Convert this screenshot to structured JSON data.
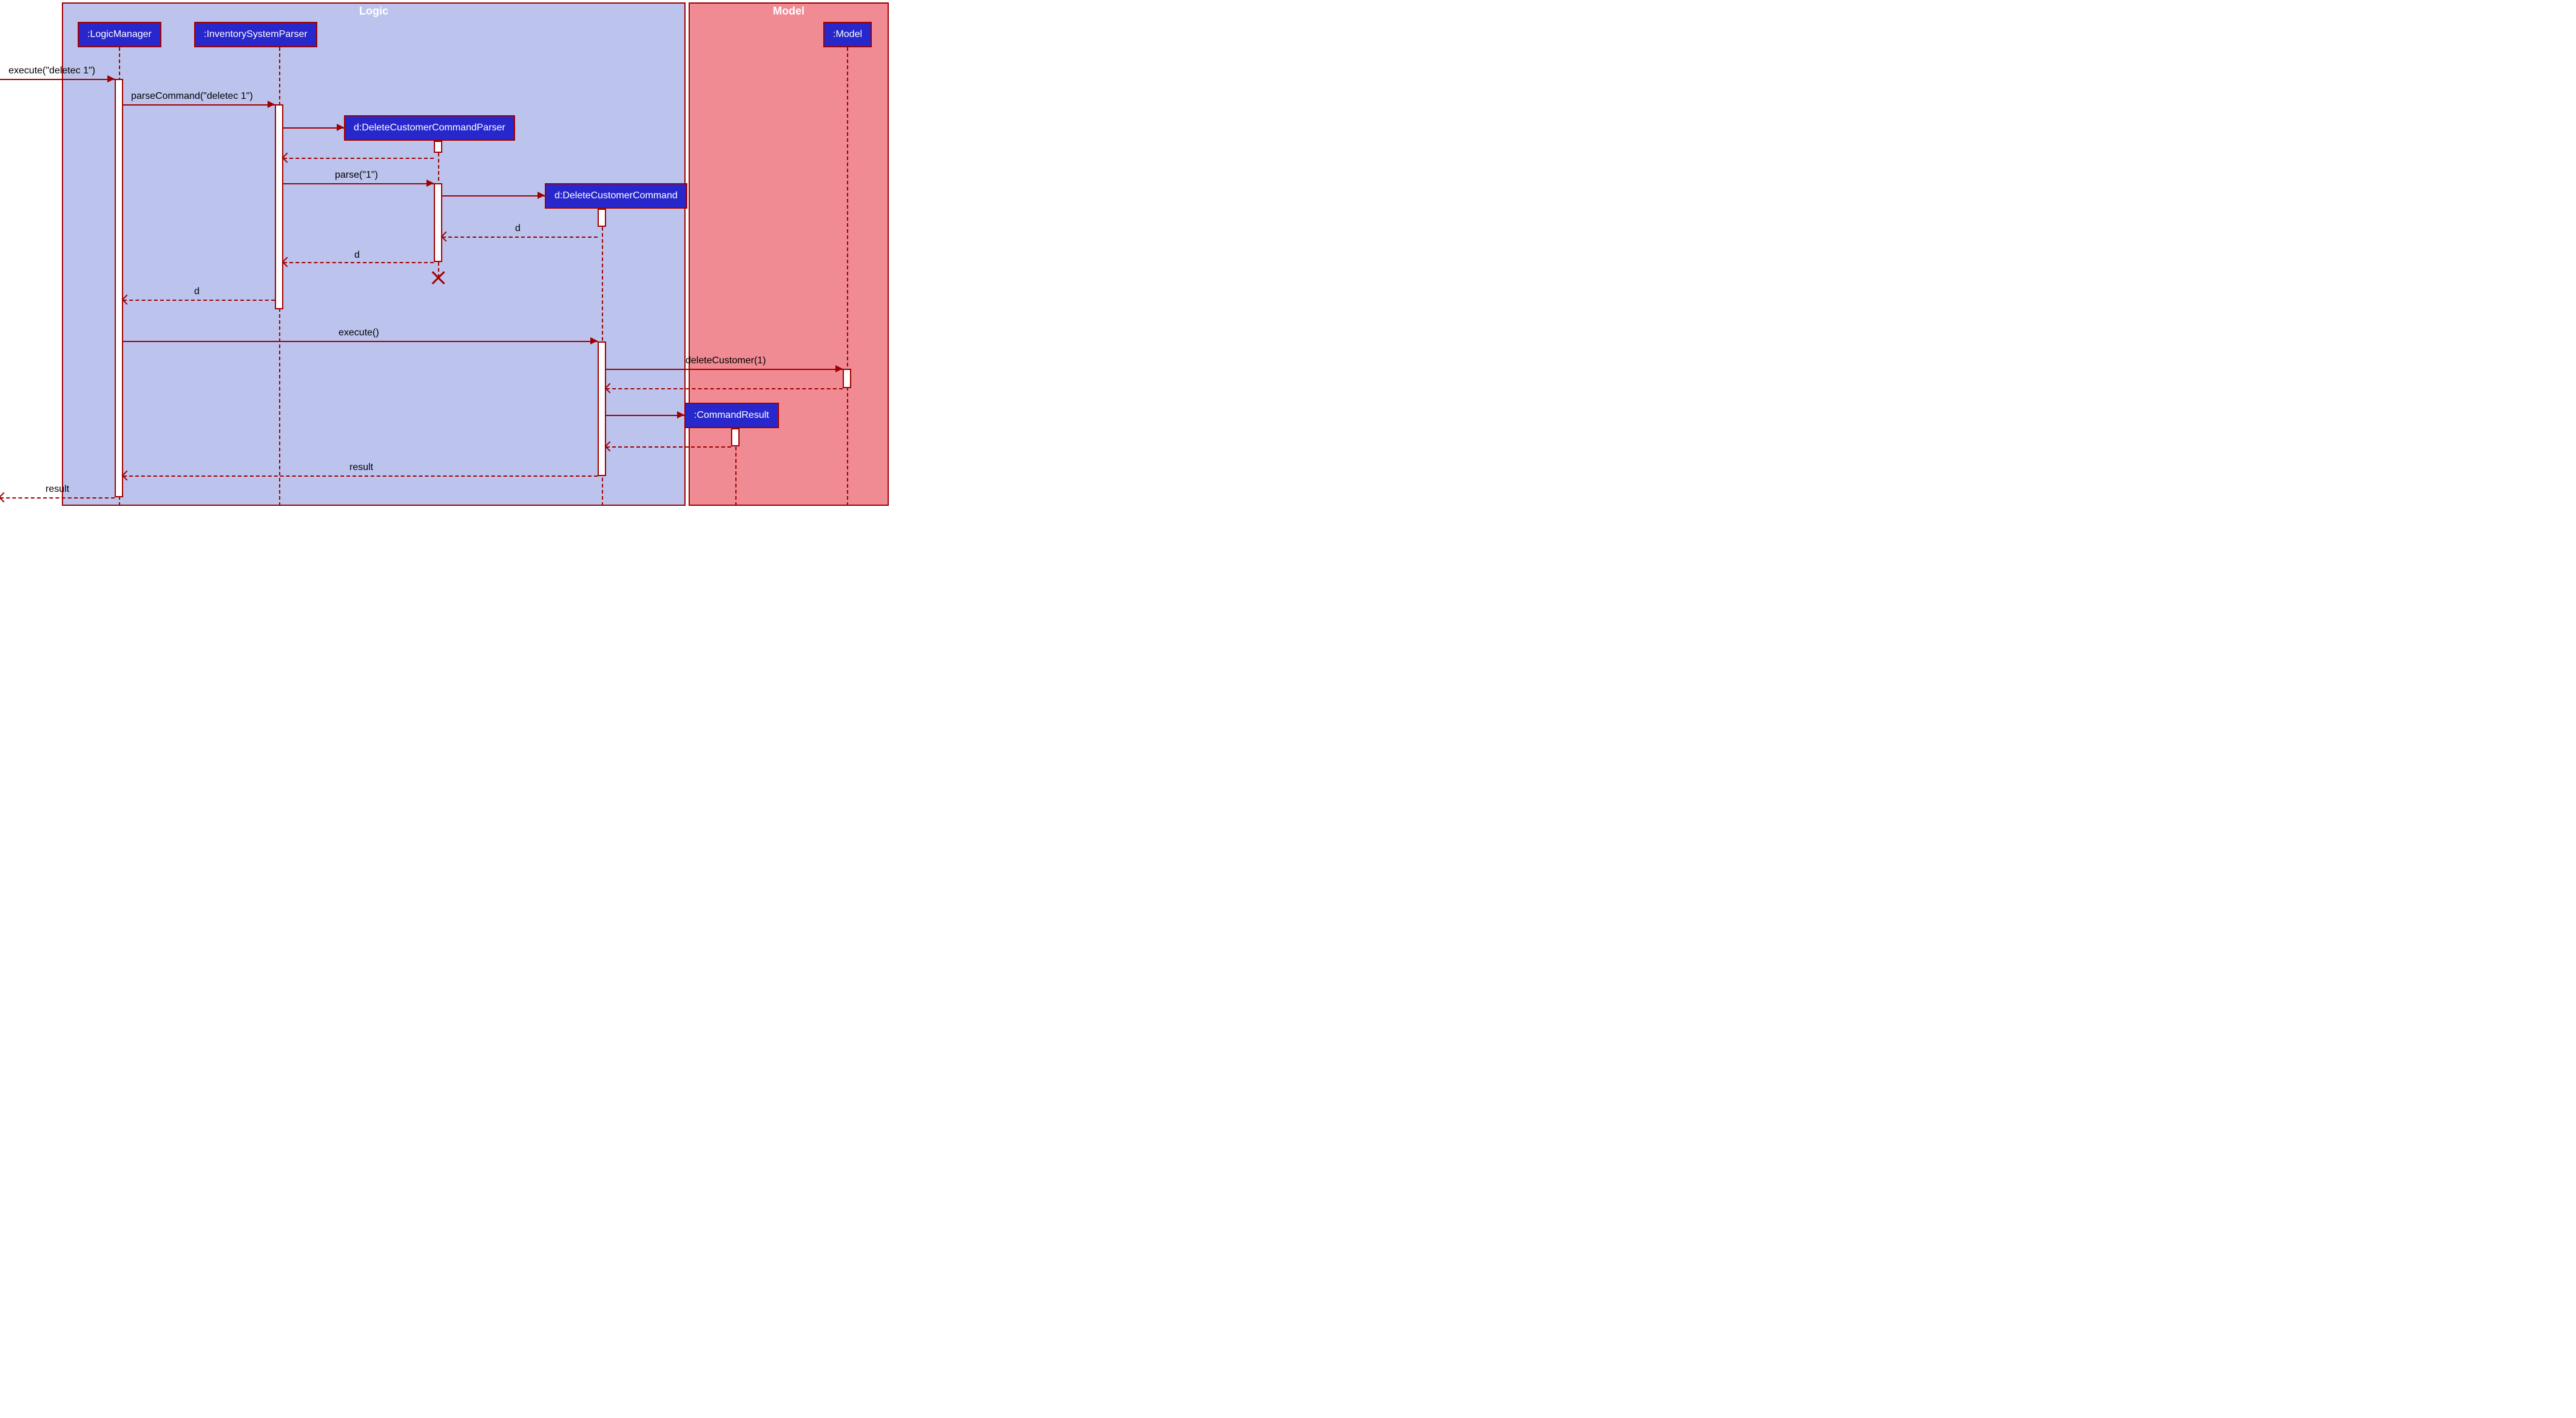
{
  "frames": {
    "logic": "Logic",
    "model": "Model"
  },
  "participants": {
    "logicManager": ":LogicManager",
    "inventoryParser": ":InventorySystemParser",
    "deleteParser": "d:DeleteCustomerCommandParser",
    "deleteCommand": "d:DeleteCustomerCommand",
    "commandResult": ":CommandResult",
    "model": ":Model"
  },
  "messages": {
    "m1": "execute(\"deletec 1\")",
    "m2": "parseCommand(\"deletec 1\")",
    "m3": "parse(\"1\")",
    "m4": "d",
    "m5": "d",
    "m6": "d",
    "m7": "execute()",
    "m8": "deleteCustomer(1)",
    "m9": "result",
    "m10": "result"
  },
  "chart_data": {
    "type": "sequence",
    "frames": [
      {
        "name": "Logic",
        "contains": [
          ":LogicManager",
          ":InventorySystemParser",
          "d:DeleteCustomerCommandParser",
          "d:DeleteCustomerCommand",
          ":CommandResult"
        ]
      },
      {
        "name": "Model",
        "contains": [
          ":Model"
        ]
      }
    ],
    "participants": [
      ":LogicManager",
      ":InventorySystemParser",
      "d:DeleteCustomerCommandParser",
      "d:DeleteCustomerCommand",
      ":Model",
      ":CommandResult"
    ],
    "messages": [
      {
        "from": "external",
        "to": ":LogicManager",
        "label": "execute(\"deletec 1\")",
        "type": "sync"
      },
      {
        "from": ":LogicManager",
        "to": ":InventorySystemParser",
        "label": "parseCommand(\"deletec 1\")",
        "type": "sync"
      },
      {
        "from": ":InventorySystemParser",
        "to": "d:DeleteCustomerCommandParser",
        "label": "",
        "type": "create"
      },
      {
        "from": "d:DeleteCustomerCommandParser",
        "to": ":InventorySystemParser",
        "label": "",
        "type": "return"
      },
      {
        "from": ":InventorySystemParser",
        "to": "d:DeleteCustomerCommandParser",
        "label": "parse(\"1\")",
        "type": "sync"
      },
      {
        "from": "d:DeleteCustomerCommandParser",
        "to": "d:DeleteCustomerCommand",
        "label": "",
        "type": "create"
      },
      {
        "from": "d:DeleteCustomerCommand",
        "to": "d:DeleteCustomerCommandParser",
        "label": "d",
        "type": "return"
      },
      {
        "from": "d:DeleteCustomerCommandParser",
        "to": ":InventorySystemParser",
        "label": "d",
        "type": "return"
      },
      {
        "from": "d:DeleteCustomerCommandParser",
        "to": "destroy",
        "label": "",
        "type": "destroy"
      },
      {
        "from": ":InventorySystemParser",
        "to": ":LogicManager",
        "label": "d",
        "type": "return"
      },
      {
        "from": ":LogicManager",
        "to": "d:DeleteCustomerCommand",
        "label": "execute()",
        "type": "sync"
      },
      {
        "from": "d:DeleteCustomerCommand",
        "to": ":Model",
        "label": "deleteCustomer(1)",
        "type": "sync"
      },
      {
        "from": ":Model",
        "to": "d:DeleteCustomerCommand",
        "label": "",
        "type": "return"
      },
      {
        "from": "d:DeleteCustomerCommand",
        "to": ":CommandResult",
        "label": "",
        "type": "create"
      },
      {
        "from": ":CommandResult",
        "to": "d:DeleteCustomerCommand",
        "label": "",
        "type": "return"
      },
      {
        "from": "d:DeleteCustomerCommand",
        "to": ":LogicManager",
        "label": "result",
        "type": "return"
      },
      {
        "from": ":LogicManager",
        "to": "external",
        "label": "result",
        "type": "return"
      }
    ]
  }
}
